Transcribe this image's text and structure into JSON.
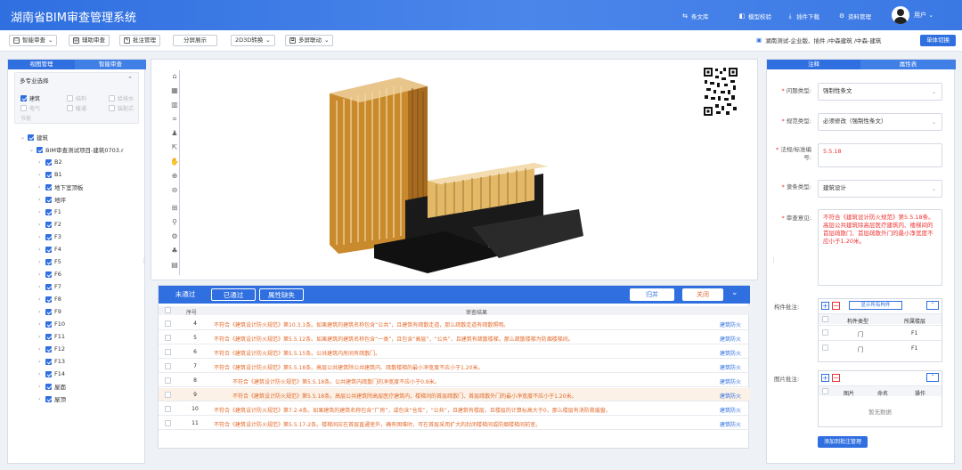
{
  "header": {
    "title": "湖南省BIM审查管理系统",
    "nav": [
      {
        "label": "条文库",
        "icon": "library-icon"
      },
      {
        "label": "模型校验",
        "icon": "model-check-icon"
      },
      {
        "label": "插件下载",
        "icon": "download-icon"
      },
      {
        "label": "资料管理",
        "icon": "gear-icon"
      }
    ],
    "user": "用户"
  },
  "toolbar": {
    "buttons": [
      {
        "label": "智能审查",
        "icon": "monitor-icon"
      },
      {
        "label": "辅助审查",
        "icon": "assist-icon"
      },
      {
        "label": "批注管理",
        "icon": "annotate-icon"
      },
      {
        "label": "分屏展示"
      },
      {
        "label": "2D3D转换"
      },
      {
        "label": "多屏联动",
        "icon": "multiscreen-icon"
      }
    ],
    "project_path": "湖南测试-企业版、插件 /中森建筑 /中森-建筑",
    "single_switch": "单体切换"
  },
  "left_panel": {
    "tabs": [
      "视图管理",
      "智能审查"
    ],
    "multi_title": "多专业选择",
    "disciplines": [
      {
        "label": "建筑",
        "checked": true
      },
      {
        "label": "结构",
        "checked": false
      },
      {
        "label": "给排水",
        "checked": false
      },
      {
        "label": "电气",
        "checked": false
      },
      {
        "label": "暖通",
        "checked": false
      },
      {
        "label": "装配式",
        "checked": false
      },
      {
        "label": "节能",
        "checked": false
      }
    ],
    "tree_root": "建筑",
    "tree_project": "BIM审查测试项目-建筑0703.r",
    "floors": [
      "B2",
      "B1",
      "地下室顶板",
      "地坪",
      "F1",
      "F2",
      "F3",
      "F4",
      "F5",
      "F6",
      "F7",
      "F8",
      "F9",
      "F10",
      "F11",
      "F12",
      "F13",
      "F14",
      "屋面",
      "屋顶"
    ]
  },
  "results": {
    "tabs": [
      "未通过",
      "已通过",
      "属性缺失"
    ],
    "merge": "归并",
    "close": "关闭",
    "head": {
      "seq": "序号",
      "result": "审查结果"
    },
    "rows": [
      {
        "no": "4",
        "text": "不符合《建筑设计防火规范》第10.3.1条。如果建筑的建筑名称包含“公共”，且建筑有疏散走道，那么疏散走道有疏散照明。",
        "tag": "建筑防火",
        "indent": false,
        "highlight": false
      },
      {
        "no": "5",
        "text": "不符合《建筑设计防火规范》第5.5.12条。如果建筑的建筑名称包含“一类”，且包含“高层”，“公共”，且建筑有疏散楼梯，那么疏散楼梯为防烟楼梯间。",
        "tag": "建筑防火",
        "indent": false,
        "highlight": false
      },
      {
        "no": "6",
        "text": "不符合《建筑设计防火规范》第5.5.15条。公共建筑内房间有疏散门。",
        "tag": "建筑防火",
        "indent": false,
        "highlight": false
      },
      {
        "no": "7",
        "text": "不符合《建筑设计防火规范》第5.5.18条。高层公共建筑除公共建筑内、疏散楼梯的最小净宽度不应小于1.20米。",
        "tag": "建筑防火",
        "indent": false,
        "highlight": false
      },
      {
        "no": "8",
        "text": "不符合《建筑设计防火规范》第5.5.18条。公共建筑内疏散门的净宽度不应小于0.9米。",
        "tag": "建筑防火",
        "indent": true,
        "highlight": false
      },
      {
        "no": "9",
        "text": "不符合《建筑设计防火规范》第5.5.18条。高层公共建筑除高层医疗建筑内，楼梯间的首层疏散门、首层疏散外门的最小净宽度不应小于1.20米。",
        "tag": "建筑防火",
        "indent": true,
        "highlight": true
      },
      {
        "no": "10",
        "text": "不符合《建筑设计防火规范》第7.2.4条。如果建筑的建筑名称包含“厂房”，或包含“仓库”，“公共”，且建筑有楼层，且楼层的计算标高大于0，那么楼层有消防救援窗。",
        "tag": "建筑防火",
        "indent": false,
        "highlight": false
      },
      {
        "no": "11",
        "text": "不符合《建筑设计防火规范》第5.5.17-2条。楼梯间应在首层直通室外，确有困难时，可在首层采用扩大的封闭楼梯间或防烟楼梯间前室。",
        "tag": "建筑防火",
        "indent": false,
        "highlight": false
      }
    ]
  },
  "right_panel": {
    "tabs": [
      "注释",
      "属性表"
    ],
    "fields": [
      {
        "label": "问题类型:",
        "value": "强制性条文",
        "dropdown": true
      },
      {
        "label": "规范类型:",
        "value": "必须修改（强制性条文）",
        "dropdown": true
      },
      {
        "label": "法规/标准编号:",
        "value": "5.5.18",
        "dropdown": false
      },
      {
        "label": "隶条类型:",
        "value": "建筑设计",
        "dropdown": true
      },
      {
        "label": "审查意见:",
        "value": "不符合《建筑设计防火规范》第5.5.18条。高层公共建筑除高层医疗建筑内、楼梯间的首层疏散门、首层疏散外门的最小净宽度不应小于1.20米。",
        "dropdown": false
      }
    ],
    "component_label": "构件批注:",
    "show_all": "显示所有构件",
    "comp_head": [
      "构件类型",
      "所属楼层"
    ],
    "comp_rows": [
      [
        "门",
        "F1"
      ],
      [
        "门",
        "F1"
      ]
    ],
    "image_label": "图片批注:",
    "img_head": [
      "图片",
      "命名",
      "操作"
    ],
    "no_data": "暂无数据",
    "add_mgmt": "添加到批注管理"
  }
}
